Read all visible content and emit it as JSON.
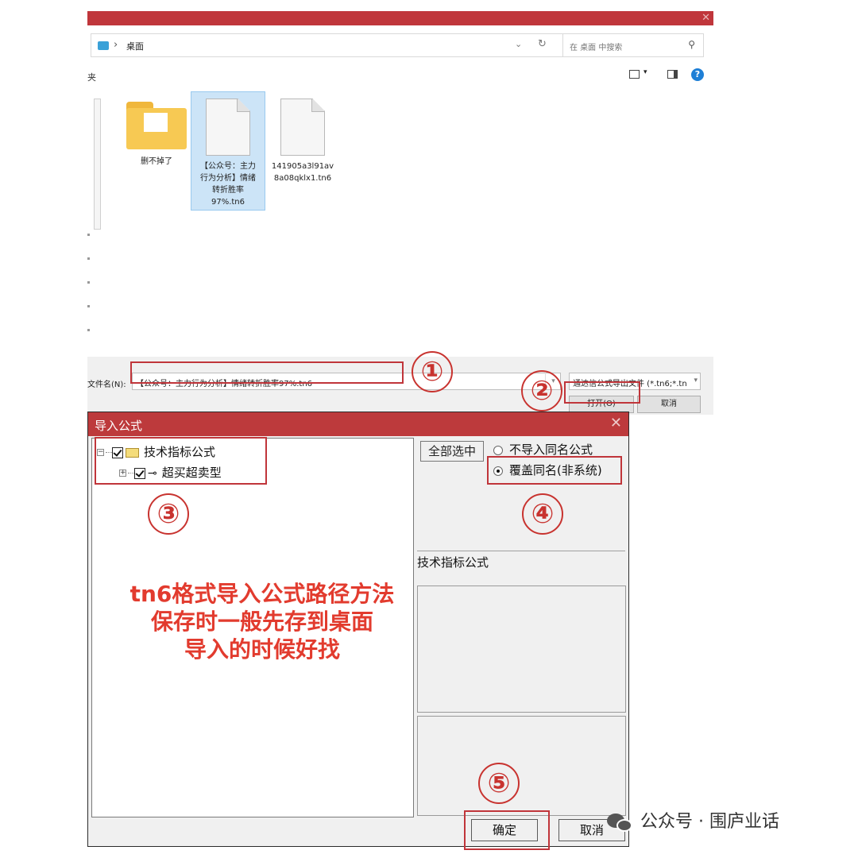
{
  "file_dialog": {
    "address_path": "桌面",
    "search_placeholder": "在 桌面 中搜索",
    "toolbar_left": "夹",
    "files": [
      {
        "name": "删不掉了",
        "type": "folder"
      },
      {
        "name": "【公众号：主力行为分析】情绪转折胜率97%.tn6",
        "lines": [
          "【公众号：主力",
          "行为分析】情绪",
          "转折胜率",
          "97%.tn6"
        ],
        "selected": true
      },
      {
        "name": "141905a3l91av8a08qklx1.tn6",
        "lines": [
          "141905a3l91av",
          "8a08qklx1.tn6"
        ]
      }
    ],
    "filename_label": "文件名(N):",
    "filename_value": "【公众号：主力行为分析】情绪转折胜率97%.tn6",
    "filter_value": "通达信公式导出文件 (*.tn6;*.tn",
    "open_label": "打开(O)",
    "cancel_label": "取消"
  },
  "import_dialog": {
    "title": "导入公式",
    "tree": [
      {
        "label": "技术指标公式",
        "toggle": "−",
        "checked": true
      },
      {
        "label": "超买超卖型",
        "toggle": "+",
        "checked": true
      }
    ],
    "select_all_label": "全部选中",
    "radio_options": [
      {
        "label": "不导入同名公式",
        "selected": false
      },
      {
        "label": "覆盖同名(非系统)",
        "selected": true
      }
    ],
    "category_label": "技术指标公式",
    "ok_label": "确定",
    "cancel_label": "取消"
  },
  "annotations": {
    "steps": [
      "①",
      "②",
      "③",
      "④",
      "⑤"
    ],
    "note_lines": [
      "tn6格式导入公式路径方法",
      "保存时一般先存到桌面",
      "导入的时候好找"
    ],
    "accent_color": "#c8332f"
  },
  "watermark": {
    "text": "公众号 · 围庐业话",
    "icon": "wechat-icon"
  }
}
